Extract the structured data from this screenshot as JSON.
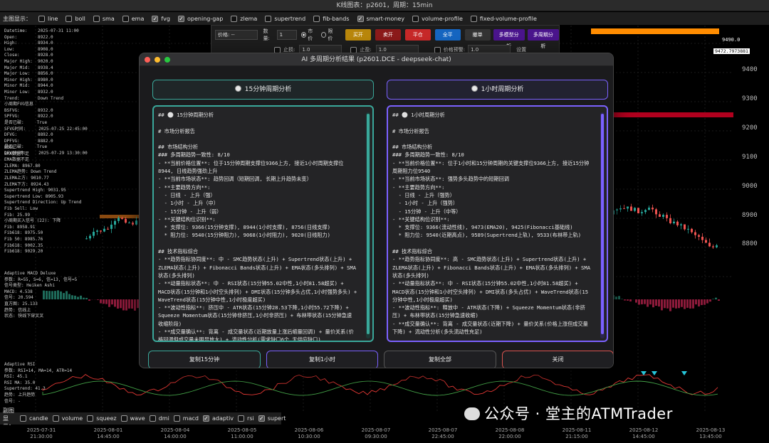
{
  "window": {
    "title": "K线图表：p2601，周期：15min"
  },
  "topbar": {
    "label": "主图显示：",
    "items": [
      {
        "label": "line",
        "checked": false
      },
      {
        "label": "boll",
        "checked": false
      },
      {
        "label": "sma",
        "checked": false
      },
      {
        "label": "ema",
        "checked": false
      },
      {
        "label": "fvg",
        "checked": true
      },
      {
        "label": "opening-gap",
        "checked": true
      },
      {
        "label": "zlema",
        "checked": false
      },
      {
        "label": "supertrend",
        "checked": false
      },
      {
        "label": "fib-bands",
        "checked": false
      },
      {
        "label": "smart-money",
        "checked": true
      },
      {
        "label": "volume-profile",
        "checked": false
      },
      {
        "label": "fixed-volume-profile",
        "checked": false
      }
    ]
  },
  "info_panel": {
    "lines_1": [
      "Datetime:    2025-07-31 11:00",
      "Open:        8922.0",
      "High:        8934.0",
      "Low:         8908.0",
      "Close:       8928.0",
      "Major High:  9020.0",
      "Major Mid:   8938.4",
      "Major Low:   8856.0",
      "Minor High:  8980.0",
      "Minor Mid:   8944.0",
      "Minor Low:   8932.0",
      "Trend:       Down Trend",
      "小周期FVG信息",
      "BSFVG:       8932.0",
      "SPFVG:       8922.0",
      "是否已破:     True",
      "SFVG时间:     2025-07-25 22:45:00",
      "DFVG:        8892.0",
      "DPFVG:       8882.0",
      "是否已破:     True",
      "DFVG时间:     2025-07-29 13:30:00"
    ],
    "lines_2": [
      "BOLL -",
      "",
      "SMA数据不足",
      "",
      "EMA数据不足",
      "",
      "ZLEMA: 8967.80",
      "ZLEMA趋势: Down Trend",
      "ZLEMA上方: 9010.77",
      "ZLEMA下方: 8924.43",
      "",
      "Supertrend High: 9031.95",
      "Supertrend Low: 8905.93",
      "Supertrend Direction: Up Trend",
      "Fib Sell: Low",
      "Fib: 25.99",
      "小周期买入信号 (22): 下降",
      "Fib: 8958.91",
      "Fib618: 8975.50",
      "Fib 50: 8985.76",
      "Fib618: 9002.35",
      "Fib618: 9029.20"
    ],
    "lines_3": [
      "Adaptive MACD Deluxe",
      "参数: R=55, S=6, 信=13, 信号=5",
      "信号类型: Heiken Ashi",
      "MACD: 4.538",
      "信号: 20.594",
      "直方图: 25.133",
      "趋势: 信线上",
      "状态: 快线下穿叉叉"
    ],
    "lines_4": [
      "Adaptive RSI",
      "参数: RSI=14, MA=14, ATR=14",
      "RSI: 45.1",
      "RSI MA: 35.0",
      "Supertrend: 41.3",
      "趋势: 上升趋势",
      "信号: -"
    ]
  },
  "price_axis": [
    "9490.0",
    "9472.7973881",
    "9400",
    "9300",
    "9200",
    "9100",
    "9000",
    "8900",
    "8800"
  ],
  "orderbar": {
    "price_label": "价格: --",
    "qty_label": "数量:",
    "qty_value": "1",
    "market_label": "市价",
    "limit_label": "限价",
    "buy_open": "买开",
    "sell_open": "卖开",
    "close_pos": "平仓",
    "close_all": "全平",
    "cancel": "撤单",
    "multi_tf_1": "多模型分析",
    "multi_tf_2": "多周期分析",
    "stop_loss_label": "止损:",
    "stop_loss_value": "1.0",
    "take_profit_label": "止盈:",
    "take_profit_value": "1.0",
    "profit_alert_label": "价格预警:",
    "profit_alert_value": "1.0",
    "settings": "设置"
  },
  "dialog": {
    "title": "AI 多周期分析结果 (p2601.DCE - deepseek-chat)",
    "left_header": "15分钟周期分析",
    "right_header": "1小时周期分析",
    "left_text": "## ⚪ 15分钟周期分析\n\n# 市场分析报告\n\n## 市场结构分析\n### 多周期趋势一致性: 8/10\n- **当前价格位置**: 位于15分钟周期支撑位9366上方, 接近1小时周期支撑位\n8944, 日线趋势强劲上升\n- **当前市场状态**: 趋势回调（短期回调, 长期上升趋势未变）\n- **主要趋势方向**:\n  - 日线 - 上升（强）\n  - 1小时 - 上升（中）\n  - 15分钟 - 上升（弱）\n- **关键结构位识别**:\n  * 支撑位: 9366(15分钟支撑), 8944(1小时支撑), 8756(日线支撑)\n  * 阻力位: 9540(15分钟阻力), 9068(1小时阻力), 9020(日线阻力)\n\n## 技术指标综合\n- **趋势指标协同度**: 中 - SMC趋势状态(上升) + Supertrend状态(上升) +\nZLEMA状态(上升) + Fibonacci Bands状态(上升) + EMA状态(多头排列) + SMA\n状态(多头排列)\n- **动量指标状态**: 中 - RSI状态(15分钟55.02中性,1小时81.58超买) +\nMACD状态(15分钟和1小时空头排列) + DMI状态(15分钟多头占优,1小时强势多头) +\nWaveTrend状态(15分钟中性,1小时极度超买)\n- **波动性指标**: 挤压中 - ATR状态(15分钟28.53下降,1小时55.72下降) +\nSqueeze Momentum状态(15分钟非挤压,1小时非挤压) + 布林带状态(15分钟急速\n收缩阶段)\n- **成交量确认**: 背离 - 成交量状态(近期放量上涨后缩量回调) + 量价关系(价\n格回调但成交量未明显放大) + 流动性分析(需求缺口6个,无供应缺口)",
    "right_text": "## ⚪ 1小时周期分析\n\n# 市场分析报告\n\n## 市场结构分析\n### 多周期趋势一致性: 8/10\n- **当前价格位置**: 位于1小时和15分钟周期的关键支撑位9366上方, 接近15分钟\n周期阻力位9540\n- **当前市场状态**: 强势多头趋势中的短期回调\n- **主要趋势方向**:\n  - 日线 - 上升（强势）\n  - 1小时 - 上升（强势）\n  - 15分钟 - 上升（中等）\n- **关键结构位识别**:\n  * 支撑位: 9366(流动性线), 9473(EMA20), 9425(Fibonacci基础线)\n  * 阻力位: 9540(近期高点), 9589(Supertrend上轨), 9533(布林带上轨)\n\n## 技术指标综合\n- **趋势指标协同度**: 高 - SMC趋势状态(上升) + Supertrend状态(上升) +\nZLEMA状态(上升) + Fibonacci Bands状态(上升) + EMA状态(多头排列) + SMA\n状态(多头排列)\n- **动量指标状态**: 中 - RSI状态(15分钟55.02中性,1小时81.58超买) +\nMACD状态(15分钟和1小时空头排列) + DMI状态(多头占优) + WaveTrend状态(15\n分钟中性,1小时极度超买)\n- **波动性指标**: 释放中 - ATR状态(下降) + Squeeze Momentum状态(非挤\n压) + 布林带状态(15分钟急速收缩)\n- **成交量确认**: 背离 - 成交量状态(近期下降) + 量价关系(价格上涨但成交量\n下降) + 流动性分析(多头流动性充足)",
    "buttons": {
      "copy_15m": "复制15分钟",
      "copy_1h": "复制1小时",
      "copy_all": "复制全部",
      "close": "关闭"
    }
  },
  "subbar": {
    "label": "副图显示：",
    "items": [
      {
        "label": "candle",
        "checked": false
      },
      {
        "label": "volume",
        "checked": false
      },
      {
        "label": "squeez",
        "checked": false
      },
      {
        "label": "wave",
        "checked": false
      },
      {
        "label": "dmi",
        "checked": false
      },
      {
        "label": "macd",
        "checked": false
      },
      {
        "label": "adaptiv",
        "checked": true
      },
      {
        "label": "rsi",
        "checked": false
      },
      {
        "label": "supert",
        "checked": true
      }
    ]
  },
  "time_axis": [
    {
      "d": "2025-07-31",
      "t": "21:30:00"
    },
    {
      "d": "2025-08-01",
      "t": "14:45:00"
    },
    {
      "d": "2025-08-04",
      "t": "14:00:00"
    },
    {
      "d": "2025-08-05",
      "t": "11:00:00"
    },
    {
      "d": "2025-08-06",
      "t": "10:30:00"
    },
    {
      "d": "2025-08-07",
      "t": "09:30:00"
    },
    {
      "d": "2025-08-07",
      "t": "22:45:00"
    },
    {
      "d": "2025-08-08",
      "t": "22:00:00"
    },
    {
      "d": "2025-08-11",
      "t": "21:15:00"
    },
    {
      "d": "2025-08-12",
      "t": "14:45:00"
    },
    {
      "d": "2025-08-13",
      "t": "13:45:00"
    }
  ],
  "watermark": "公众号 · 堂主的ATMTrader",
  "colors": {
    "bull": "#26a69a",
    "bear": "#ef5350",
    "accent_left": "#3aa89a",
    "accent_right": "#7b61ff",
    "close_btn": "#d9534f",
    "orange_zone": "#ff8c00",
    "red_zone": "#b0001e"
  }
}
